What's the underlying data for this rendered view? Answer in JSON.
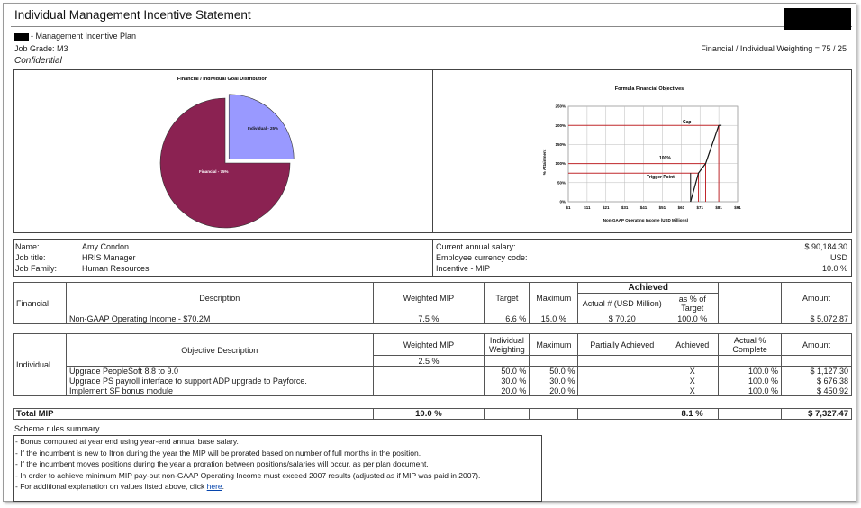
{
  "header": {
    "title": "Individual Management Incentive Statement",
    "plan_name": "- Management Incentive Plan",
    "job_grade": "Job Grade: M3",
    "weighting": "Financial / Individual Weighting = 75 / 25",
    "confidential": "Confidential"
  },
  "pie": {
    "title": "Financial / Individual Goal Distribution",
    "individual_label": "Individual - 25%",
    "financial_label": "Financial - 75%",
    "colors": {
      "individual": "#9999ff",
      "financial": "#8b2252"
    }
  },
  "formula": {
    "title": "Formula Financial Objectives",
    "ylabel": "% Attainment",
    "xlabel": "Non-GAAP Operating Income (USD Millions)",
    "yticks": [
      "250%",
      "200%",
      "150%",
      "100%",
      "50%",
      "0%"
    ],
    "xticks": [
      "$1",
      "$11",
      "$21",
      "$31",
      "$41",
      "$51",
      "$61",
      "$71",
      "$81",
      "$91"
    ],
    "cap_label": "Cap",
    "hundred_label": "100%",
    "trigger_label": "Trigger Point"
  },
  "chart_data": [
    {
      "type": "pie",
      "title": "Financial / Individual Goal Distribution",
      "labels": [
        "Individual - 25%",
        "Financial - 75%"
      ],
      "values": [
        25,
        75
      ]
    },
    {
      "type": "line",
      "title": "Formula Financial Objectives",
      "xlabel": "Non-GAAP Operating Income (USD Millions)",
      "ylabel": "% Attainment",
      "x": [
        66,
        70.2,
        74,
        81
      ],
      "y": [
        0,
        75,
        100,
        200
      ],
      "xlim": [
        1,
        91
      ],
      "ylim": [
        0,
        250
      ],
      "hlines": [
        {
          "label": "Cap",
          "y": 200
        },
        {
          "label": "100%",
          "y": 100
        },
        {
          "label": "Trigger Point",
          "y": 75
        }
      ],
      "vlines": [
        66,
        70.2,
        74,
        81
      ]
    }
  ],
  "employee": {
    "name_label": "Name:",
    "name": "Amy Condon",
    "title_label": "Job title:",
    "title": "HRIS Manager",
    "family_label": "Job Family:",
    "family": "Human Resources",
    "salary_label": "Current annual salary:",
    "salary": "$ 90,184.30",
    "currency_label": "Employee currency code:",
    "currency": "USD",
    "incentive_label": "Incentive - MIP",
    "incentive": "10.0 %"
  },
  "financial": {
    "section": "Financial",
    "h_description": "Description",
    "h_weighted": "Weighted MIP",
    "h_target": "Target",
    "h_maximum": "Maximum",
    "h_achieved": "Achieved",
    "h_actual": "Actual # (USD Million)",
    "h_pct_target": "as % of Target",
    "h_amount": "Amount",
    "row": {
      "description": "Non-GAAP Operating Income - $70.2M",
      "weighted": "7.5 %",
      "target": "6.6 %",
      "maximum": "15.0 %",
      "actual": "$ 70.20",
      "pct": "100.0 %",
      "amount": "$ 5,072.87"
    }
  },
  "individual": {
    "section": "Individual",
    "h_objective": "Objective Description",
    "h_weighted": "Weighted MIP",
    "h_weighting": "Individual Weighting",
    "h_maximum": "Maximum",
    "h_partial": "Partially Achieved",
    "h_achieved": "Achieved",
    "h_complete": "Actual % Complete",
    "h_amount": "Amount",
    "weighted_value": "2.5 %",
    "rows": [
      {
        "objective": "Upgrade PeopleSoft 8.8 to 9.0",
        "weighting": "50.0 %",
        "maximum": "50.0 %",
        "achieved": "X",
        "complete": "100.0 %",
        "amount": "$ 1,127.30"
      },
      {
        "objective": "Upgrade PS payroll interface to support ADP upgrade to Payforce.",
        "weighting": "30.0 %",
        "maximum": "30.0 %",
        "achieved": "X",
        "complete": "100.0 %",
        "amount": "$ 676.38"
      },
      {
        "objective": "Implement SF bonus module",
        "weighting": "20.0 %",
        "maximum": "20.0 %",
        "achieved": "X",
        "complete": "100.0 %",
        "amount": "$ 450.92"
      }
    ]
  },
  "total": {
    "label": "Total MIP",
    "weighted": "10.0 %",
    "pct": "8.1 %",
    "amount": "$ 7,327.47"
  },
  "scheme": {
    "title": "Scheme rules summary",
    "rules": [
      "- Bonus computed at year end using year-end annual base salary.",
      "- If the incumbent is new to Itron during the year the MIP will be prorated based on number of full months in the position.",
      "- If the incumbent moves positions during the year a proration between positions/salaries will occur, as per plan document.",
      "- In order to achieve minimum MIP pay-out non-GAAP Operating Income must exceed 2007 results (adjusted as if MIP was paid in 2007)."
    ],
    "last_prefix": "- For additional explanation on values listed above, click",
    "link_text": "here",
    "last_suffix": "."
  }
}
